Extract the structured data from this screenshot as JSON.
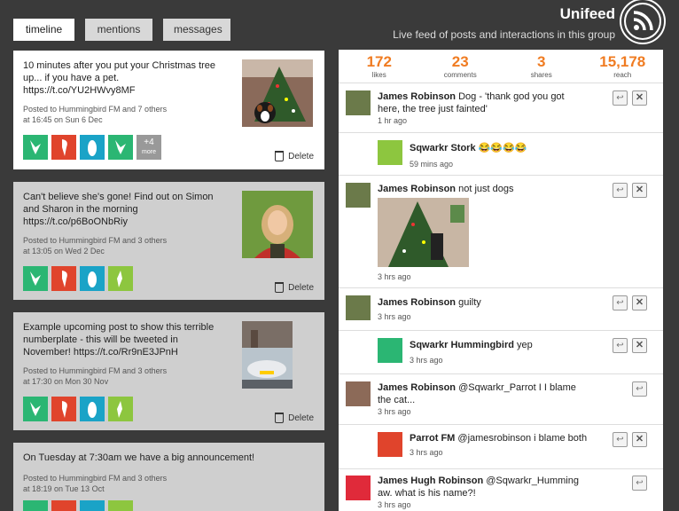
{
  "tabs": [
    "timeline",
    "mentions",
    "messages"
  ],
  "brand": {
    "title": "Unifeed",
    "subtitle": "Live feed of posts and interactions in this group"
  },
  "posts": [
    {
      "text": "10 minutes after you put your Christmas tree up... if you have a pet. https://t.co/YU2HWvy8MF",
      "meta1": "Posted to Hummingbird FM and 7 others",
      "meta2": "at 16:45 on Sun 6 Dec",
      "more_count": "+4",
      "more_label": "more",
      "delete": "Delete"
    },
    {
      "text": "Can't believe she's gone! Find out on Simon and Sharon in the morning https://t.co/p6BoONbRiy",
      "meta1": "Posted to Hummingbird FM and 3 others",
      "meta2": "at 13:05 on Wed 2 Dec",
      "delete": "Delete"
    },
    {
      "text": "Example upcoming post to show this terrible numberplate - this will be tweeted in November! https://t.co/Rr9nE3JPnH",
      "meta1": "Posted to Hummingbird FM and 3 others",
      "meta2": "at 17:30 on Mon 30 Nov",
      "delete": "Delete"
    },
    {
      "text": "On Tuesday at 7:30am we have a big announcement!",
      "meta1": "Posted to Hummingbird FM and 3 others",
      "meta2": "at 18:19 on Tue 13 Oct"
    }
  ],
  "stats": [
    {
      "num": "172",
      "label": "likes"
    },
    {
      "num": "23",
      "label": "comments"
    },
    {
      "num": "3",
      "label": "shares"
    },
    {
      "num": "15,178",
      "label": "reach"
    }
  ],
  "feed": [
    {
      "name": "James Robinson",
      "text": "Dog - 'thank god you got here, the tree just fainted'",
      "time": "1 hr ago"
    },
    {
      "name": "Sqwarkr Stork",
      "text": "😂😂😂😂",
      "time": "59 mins ago"
    },
    {
      "name": "James Robinson",
      "text": "not just dogs",
      "time": "3 hrs ago"
    },
    {
      "name": "James Robinson",
      "text": "guilty",
      "time": "3 hrs ago"
    },
    {
      "name": "Sqwarkr Hummingbird",
      "text": "yep",
      "time": "3 hrs ago"
    },
    {
      "name": "James Robinson",
      "text": "@Sqwarkr_Parrot I I blame the cat...",
      "time": "3 hrs ago"
    },
    {
      "name": "Parrot FM",
      "text": "@jamesrobinson i blame both",
      "time": "3 hrs ago"
    },
    {
      "name": "James Hugh Robinson",
      "text": "@Sqwarkr_Humming aw. what is his name?!",
      "time": "3 hrs ago"
    }
  ],
  "colors": {
    "accent": "#f07c22",
    "hummingbird": "#2bb673",
    "parrot": "#e0442c",
    "penguin": "#1aa3c7",
    "stork": "#8dc63f",
    "darkbg": "#3a3a3a"
  },
  "icons": {
    "rss": "rss-icon",
    "reply": "reply-icon",
    "dismiss": "close-icon",
    "delete": "trash-icon"
  }
}
